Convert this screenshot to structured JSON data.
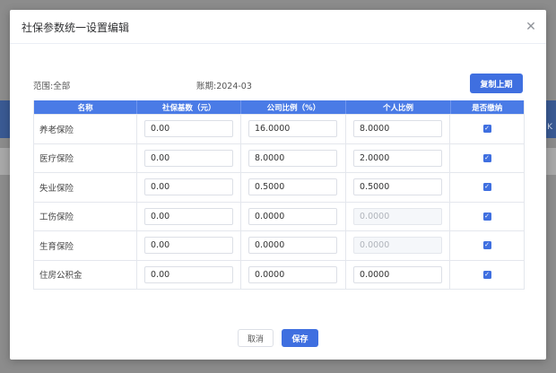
{
  "background": {
    "edge_text": "K"
  },
  "dialog": {
    "title": "社保参数统一设置编辑",
    "close_icon": "close-icon",
    "scope": "范围:全部",
    "period": "账期:2024-03",
    "copy_label": "复制上期"
  },
  "table": {
    "headers": [
      "名称",
      "社保基数（元）",
      "公司比例（%）",
      "个人比例",
      "是否缴纳"
    ],
    "rows": [
      {
        "name": "养老保险",
        "base": "0.00",
        "company": "16.0000",
        "personal": "8.0000",
        "personal_disabled": false,
        "paid": true
      },
      {
        "name": "医疗保险",
        "base": "0.00",
        "company": "8.0000",
        "personal": "2.0000",
        "personal_disabled": false,
        "paid": true
      },
      {
        "name": "失业保险",
        "base": "0.00",
        "company": "0.5000",
        "personal": "0.5000",
        "personal_disabled": false,
        "paid": true
      },
      {
        "name": "工伤保险",
        "base": "0.00",
        "company": "0.0000",
        "personal": "0.0000",
        "personal_disabled": true,
        "paid": true
      },
      {
        "name": "生育保险",
        "base": "0.00",
        "company": "0.0000",
        "personal": "0.0000",
        "personal_disabled": true,
        "paid": true
      },
      {
        "name": "住房公积金",
        "base": "0.00",
        "company": "0.0000",
        "personal": "0.0000",
        "personal_disabled": false,
        "paid": true
      }
    ]
  },
  "footer": {
    "cancel_label": "取消",
    "save_label": "保存"
  },
  "colors": {
    "accent": "#3f6fe0",
    "header_bg": "#4a7be6",
    "overlay": "#8c8c8c"
  }
}
